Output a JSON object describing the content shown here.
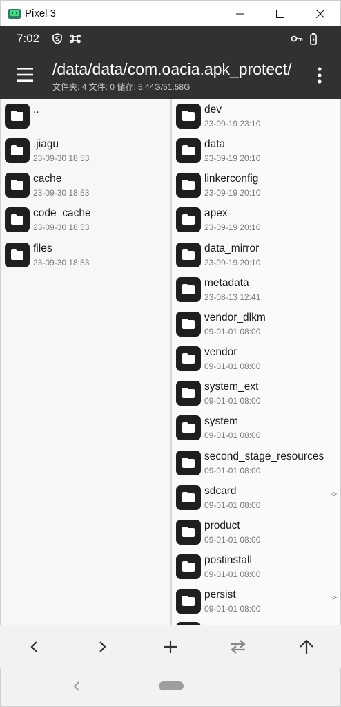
{
  "window": {
    "title": "Pixel 3",
    "icon": "android-emulator-icon",
    "controls": [
      "minimize-icon",
      "maximize-icon",
      "close-icon"
    ]
  },
  "status_bar": {
    "time": "7:02",
    "left_icons": [
      "shield-s-icon",
      "command-icon"
    ],
    "right_icons": [
      "key-icon",
      "battery-charging-icon"
    ]
  },
  "app_bar": {
    "path": "/data/data/com.oacia.apk_protect/",
    "summary": "文件夹: 4  文件: 0  储存: 5.44G/51.58G",
    "menu_icon": "hamburger-menu-icon",
    "more_icon": "more-vert-icon"
  },
  "left_panel": {
    "items": [
      {
        "name": "..",
        "date": ""
      },
      {
        "name": ".jiagu",
        "date": "23-09-30 18:53"
      },
      {
        "name": "cache",
        "date": "23-09-30 18:53"
      },
      {
        "name": "code_cache",
        "date": "23-09-30 18:53"
      },
      {
        "name": "files",
        "date": "23-09-30 18:53"
      }
    ]
  },
  "right_panel": {
    "items": [
      {
        "name": "dev",
        "date": "23-09-19 23:10",
        "link": ""
      },
      {
        "name": "data",
        "date": "23-09-19 20:10",
        "link": ""
      },
      {
        "name": "linkerconfig",
        "date": "23-09-19 20:10",
        "link": ""
      },
      {
        "name": "apex",
        "date": "23-09-19 20:10",
        "link": ""
      },
      {
        "name": "data_mirror",
        "date": "23-09-19 20:10",
        "link": ""
      },
      {
        "name": "metadata",
        "date": "23-08-13 12:41",
        "link": ""
      },
      {
        "name": "vendor_dlkm",
        "date": "09-01-01 08:00",
        "link": ""
      },
      {
        "name": "vendor",
        "date": "09-01-01 08:00",
        "link": ""
      },
      {
        "name": "system_ext",
        "date": "09-01-01 08:00",
        "link": ""
      },
      {
        "name": "system",
        "date": "09-01-01 08:00",
        "link": ""
      },
      {
        "name": "second_stage_resources",
        "date": "09-01-01 08:00",
        "link": ""
      },
      {
        "name": "sdcard",
        "date": "09-01-01 08:00",
        "link": "->"
      },
      {
        "name": "product",
        "date": "09-01-01 08:00",
        "link": ""
      },
      {
        "name": "postinstall",
        "date": "09-01-01 08:00",
        "link": ""
      },
      {
        "name": "persist",
        "date": "09-01-01 08:00",
        "link": "->"
      }
    ]
  },
  "toolbar": {
    "buttons": [
      "back-icon",
      "forward-icon",
      "add-icon",
      "swap-icon",
      "up-icon"
    ]
  },
  "nav_bar": {
    "buttons": [
      "nav-back-icon",
      "nav-home-pill"
    ]
  }
}
